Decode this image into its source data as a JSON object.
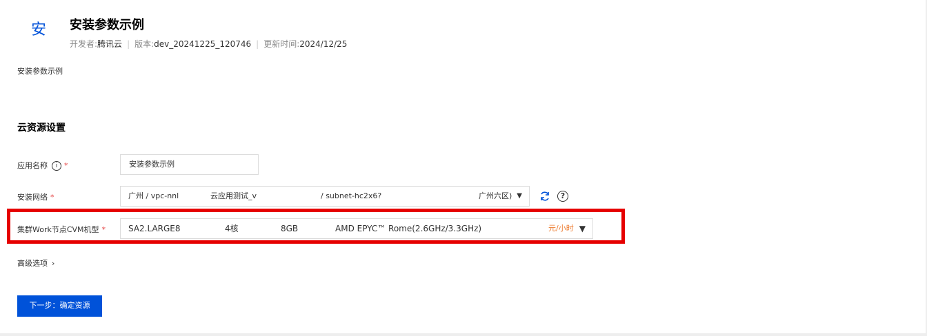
{
  "app": {
    "icon_char": "安",
    "title": "安装参数示例",
    "developer_label": "开发者:",
    "developer": "腾讯云",
    "version_label": "版本:",
    "version": "dev_20241225_120746",
    "updated_label": "更新时间:",
    "updated": "2024/12/25"
  },
  "description": "安装参数示例",
  "section_title": "云资源设置",
  "fields": {
    "app_name": {
      "label": "应用名称",
      "value": "安装参数示例"
    },
    "network": {
      "label": "安装网络",
      "region": "广州 / vpc-nnl",
      "vpc_name": "云应用测试_v",
      "subnet": "/ subnet-hc2x6?",
      "zone": "广州六区)"
    },
    "cvm": {
      "label": "集群Work节点CVM机型",
      "model": "SA2.LARGE8",
      "cores": "4核",
      "memory": "8GB",
      "cpu": "AMD EPYC™ Rome(2.6GHz/3.3GHz)",
      "price": "元/小时"
    }
  },
  "advanced_label": "高级选项",
  "next_button": "下一步：确定资源",
  "colors": {
    "primary": "#0052d9",
    "required": "#e54545",
    "price": "#ed7b2f",
    "highlight": "#e60000"
  }
}
